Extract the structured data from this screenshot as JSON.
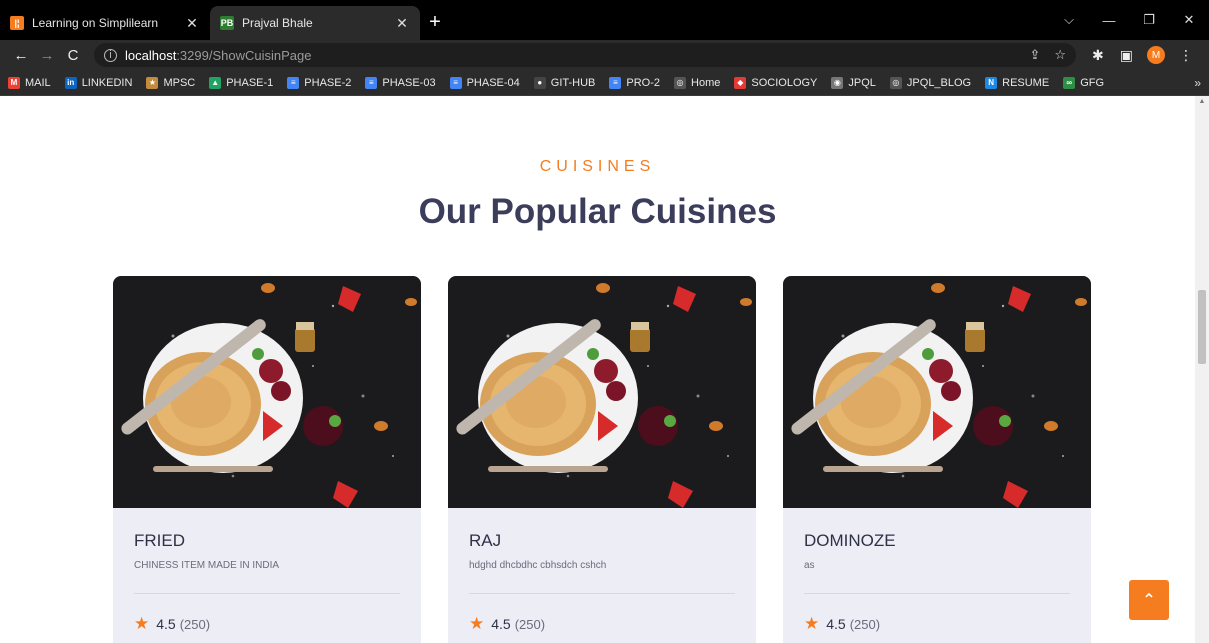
{
  "browser": {
    "tabs": [
      {
        "title": "Learning on Simplilearn",
        "favicon": "simplilearn-logo",
        "active": false
      },
      {
        "title": "Prajval Bhale",
        "favicon": "PB",
        "active": true
      }
    ],
    "new_tab": "+",
    "url_host": "localhost",
    "url_path": ":3299/ShowCuisinPage",
    "avatar_letter": "M",
    "bookmarks": [
      {
        "label": "MAIL",
        "color": "#ea4335",
        "icon": "M"
      },
      {
        "label": "LINKEDIN",
        "color": "#0a66c2",
        "icon": "in"
      },
      {
        "label": "MPSC",
        "color": "#c48b3c",
        "icon": "★"
      },
      {
        "label": "PHASE-1",
        "color": "#1fa463",
        "icon": "▲"
      },
      {
        "label": "PHASE-2",
        "color": "#4285f4",
        "icon": "≡"
      },
      {
        "label": "PHASE-03",
        "color": "#4285f4",
        "icon": "≡"
      },
      {
        "label": "PHASE-04",
        "color": "#4285f4",
        "icon": "≡"
      },
      {
        "label": "GIT-HUB",
        "color": "#444444",
        "icon": "●"
      },
      {
        "label": "PRO-2",
        "color": "#4285f4",
        "icon": "≡"
      },
      {
        "label": "Home",
        "color": "#555555",
        "icon": "◎"
      },
      {
        "label": "SOCIOLOGY",
        "color": "#e53935",
        "icon": "◆"
      },
      {
        "label": "JPQL",
        "color": "#777777",
        "icon": "◉"
      },
      {
        "label": "JPQL_BLOG",
        "color": "#555555",
        "icon": "◎"
      },
      {
        "label": "RESUME",
        "color": "#1e88e5",
        "icon": "N"
      },
      {
        "label": "GFG",
        "color": "#2f8d46",
        "icon": "∞"
      }
    ],
    "bookmarks_more": "»"
  },
  "section": {
    "subtitle": "CUISINES",
    "title": "Our Popular Cuisines"
  },
  "cuisines": [
    {
      "name": "FRIED",
      "description": "CHINESS ITEM MADE IN INDIA",
      "rating": "4.5",
      "reviews": "(250)"
    },
    {
      "name": "RAJ",
      "description": "hdghd dhcbdhc cbhsdch cshch",
      "rating": "4.5",
      "reviews": "(250)"
    },
    {
      "name": "DOMINOZE",
      "description": "as",
      "rating": "4.5",
      "reviews": "(250)"
    }
  ],
  "colors": {
    "accent": "#f57c1f",
    "title": "#3b3d5a",
    "card_bg": "#ecedf5"
  }
}
